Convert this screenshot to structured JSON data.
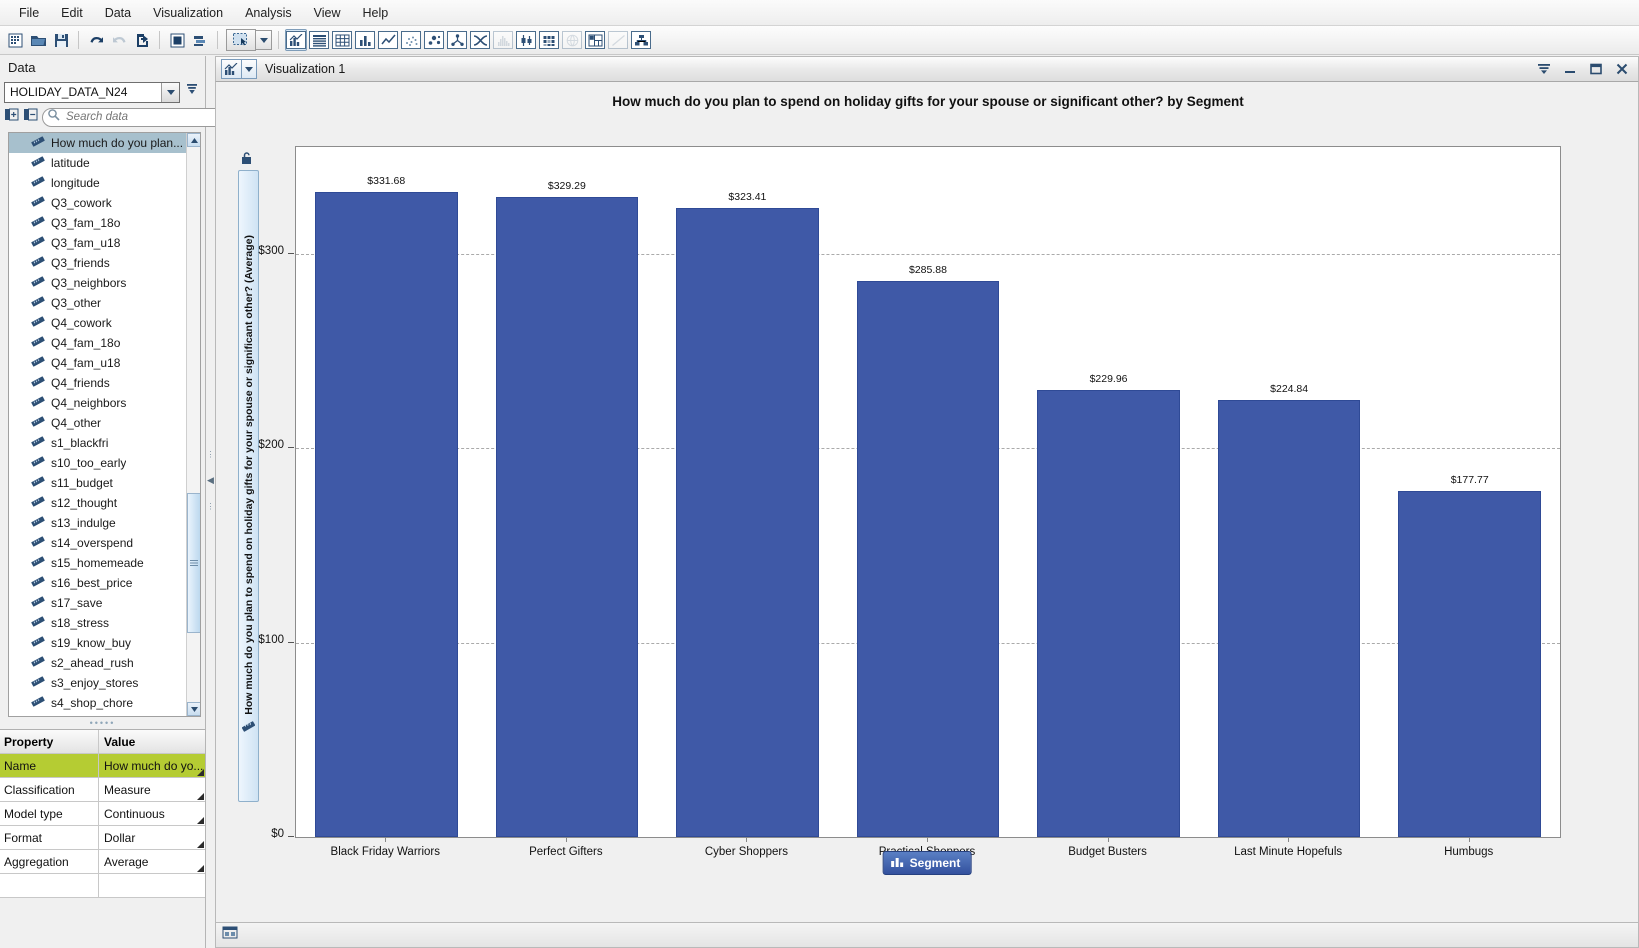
{
  "menu": {
    "items": [
      "File",
      "Edit",
      "Data",
      "Visualization",
      "Analysis",
      "View",
      "Help"
    ]
  },
  "toolbar": {
    "icons": [
      "new-document-icon",
      "open-folder-icon",
      "save-icon",
      "undo-icon",
      "redo-icon",
      "export-icon",
      "stop-icon",
      "layers-icon",
      "select-mode-icon",
      "select-dropdown-caret-icon",
      "auto-chart-icon",
      "table-icon",
      "crosstab-icon",
      "bar-chart-icon",
      "line-chart-icon",
      "scatter-plot-icon",
      "bubble-plot-icon",
      "network-icon",
      "sankey-icon",
      "histogram-icon",
      "box-plot-icon",
      "heat-map-icon",
      "geo-map-icon",
      "treemap-icon",
      "regression-icon",
      "decision-tree-icon"
    ]
  },
  "left_panel": {
    "title": "Data",
    "data_source": {
      "value": "HOLIDAY_DATA_N24",
      "caret_icon": "chevron-down-icon"
    },
    "filter_icon": "filter-icon",
    "expand_all_icon": "expand-all-icon",
    "collapse_all_icon": "collapse-all-icon",
    "search": {
      "placeholder": "Search data",
      "value": "",
      "icon": "search-icon"
    },
    "fields": [
      "How much do you plan...",
      "latitude",
      "longitude",
      "Q3_cowork",
      "Q3_fam_18o",
      "Q3_fam_u18",
      "Q3_friends",
      "Q3_neighbors",
      "Q3_other",
      "Q4_cowork",
      "Q4_fam_18o",
      "Q4_fam_u18",
      "Q4_friends",
      "Q4_neighbors",
      "Q4_other",
      "s1_blackfri",
      "s10_too_early",
      "s11_budget",
      "s12_thought",
      "s13_indulge",
      "s14_overspend",
      "s15_homemeade",
      "s16_best_price",
      "s17_save",
      "s18_stress",
      "s19_know_buy",
      "s2_ahead_rush",
      "s3_enjoy_stores",
      "s4_shop_chore"
    ],
    "selected_field_index": 0,
    "scroll_up_icon": "scroll-up-arrow-icon",
    "scroll_down_icon": "scroll-down-arrow-icon",
    "properties": {
      "headers": [
        "Property",
        "Value"
      ],
      "rows": [
        {
          "name": "Name",
          "value": "How much do yo...",
          "selected": true
        },
        {
          "name": "Classification",
          "value": "Measure",
          "selected": false
        },
        {
          "name": "Model type",
          "value": "Continuous",
          "selected": false
        },
        {
          "name": "Format",
          "value": "Dollar",
          "selected": false
        },
        {
          "name": "Aggregation",
          "value": "Average",
          "selected": false
        },
        {
          "name": "",
          "value": "",
          "selected": false
        }
      ]
    }
  },
  "viz_window": {
    "icon": "bar-chart-icon",
    "caret_icon": "chevron-down-icon",
    "name": "Visualization 1",
    "menu_icon": "window-menu-icon",
    "minimize_icon": "minimize-icon",
    "maximize_icon": "maximize-icon",
    "close_icon": "close-icon",
    "status_icon": "viz-status-icon",
    "segment_button": {
      "label": "Segment",
      "icon": "category-icon"
    },
    "y_axis_lock_icon": "axis-lock-icon",
    "y_axis_measure_icon": "measure-icon"
  },
  "chart_data": {
    "type": "bar",
    "title": "How much do you plan to spend on holiday gifts for your spouse or significant other? by Segment",
    "xlabel": "Segment",
    "ylabel": "How much do you plan to spend on holiday gifts for your spouse or significant other? (Average)",
    "ylim": [
      0,
      355
    ],
    "yticks": [
      0,
      100,
      200,
      300
    ],
    "ytick_labels": [
      "$0",
      "$100",
      "$200",
      "$300"
    ],
    "grid": true,
    "legend": "none",
    "bar_color": "#3f59a7",
    "categories": [
      "Black Friday Warriors",
      "Perfect Gifters",
      "Cyber Shoppers",
      "Practical Shoppers",
      "Budget Busters",
      "Last Minute Hopefuls",
      "Humbugs"
    ],
    "values": [
      331.68,
      329.29,
      323.41,
      285.88,
      229.96,
      224.84,
      177.77
    ],
    "value_labels": [
      "$331.68",
      "$329.29",
      "$323.41",
      "$285.88",
      "$229.96",
      "$224.84",
      "$177.77"
    ]
  }
}
